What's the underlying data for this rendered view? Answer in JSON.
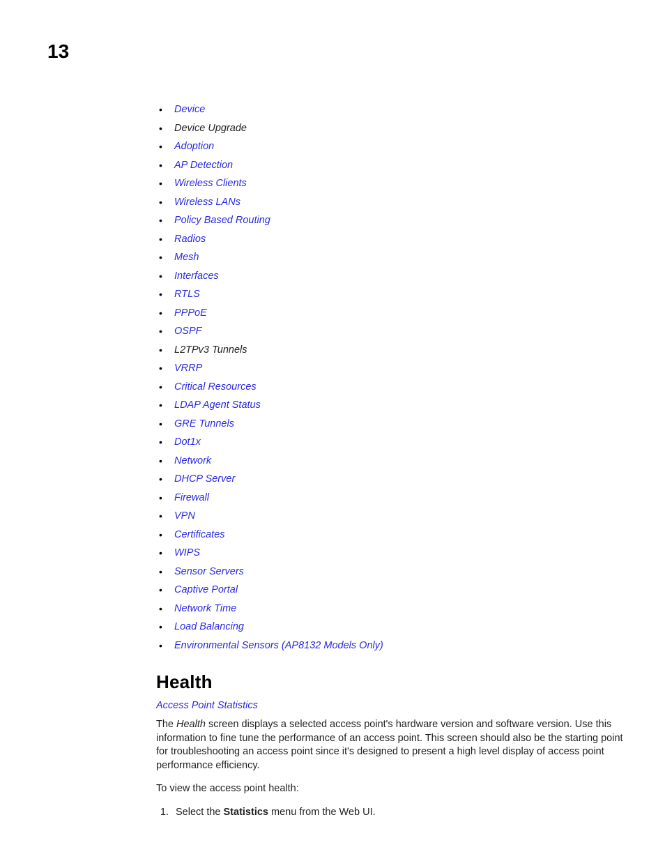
{
  "page_number": "13",
  "toc": [
    {
      "label": "Device",
      "link": true
    },
    {
      "label": "Device Upgrade",
      "link": false
    },
    {
      "label": "Adoption",
      "link": true
    },
    {
      "label": "AP Detection",
      "link": true
    },
    {
      "label": "Wireless Clients",
      "link": true
    },
    {
      "label": "Wireless LANs",
      "link": true
    },
    {
      "label": "Policy Based Routing",
      "link": true
    },
    {
      "label": "Radios",
      "link": true
    },
    {
      "label": "Mesh",
      "link": true
    },
    {
      "label": "Interfaces",
      "link": true
    },
    {
      "label": "RTLS",
      "link": true
    },
    {
      "label": "PPPoE",
      "link": true
    },
    {
      "label": "OSPF",
      "link": true
    },
    {
      "label": "L2TPv3 Tunnels",
      "link": false
    },
    {
      "label": "VRRP",
      "link": true
    },
    {
      "label": "Critical Resources",
      "link": true
    },
    {
      "label": "LDAP Agent Status",
      "link": true
    },
    {
      "label": "GRE Tunnels",
      "link": true
    },
    {
      "label": "Dot1x",
      "link": true
    },
    {
      "label": "Network",
      "link": true
    },
    {
      "label": "DHCP Server",
      "link": true
    },
    {
      "label": "Firewall",
      "link": true
    },
    {
      "label": "VPN",
      "link": true
    },
    {
      "label": "Certificates",
      "link": true
    },
    {
      "label": "WIPS",
      "link": true
    },
    {
      "label": "Sensor Servers",
      "link": true
    },
    {
      "label": "Captive Portal",
      "link": true
    },
    {
      "label": "Network Time",
      "link": true
    },
    {
      "label": "Load Balancing",
      "link": true
    },
    {
      "label": "Environmental Sensors (AP8132 Models Only)",
      "link": true
    }
  ],
  "section": {
    "heading": "Health",
    "sublink": "Access Point Statistics",
    "para1_a": "The ",
    "para1_b": "Health",
    "para1_c": " screen displays a selected access point's hardware version and software version. Use this information to fine tune the performance of an access point. This screen should also be the starting point for troubleshooting an access point since it's designed to present a high level display of access point performance efficiency.",
    "para2": "To view the access point health:",
    "step1_a": "Select the ",
    "step1_b": "Statistics",
    "step1_c": " menu from the Web UI."
  }
}
